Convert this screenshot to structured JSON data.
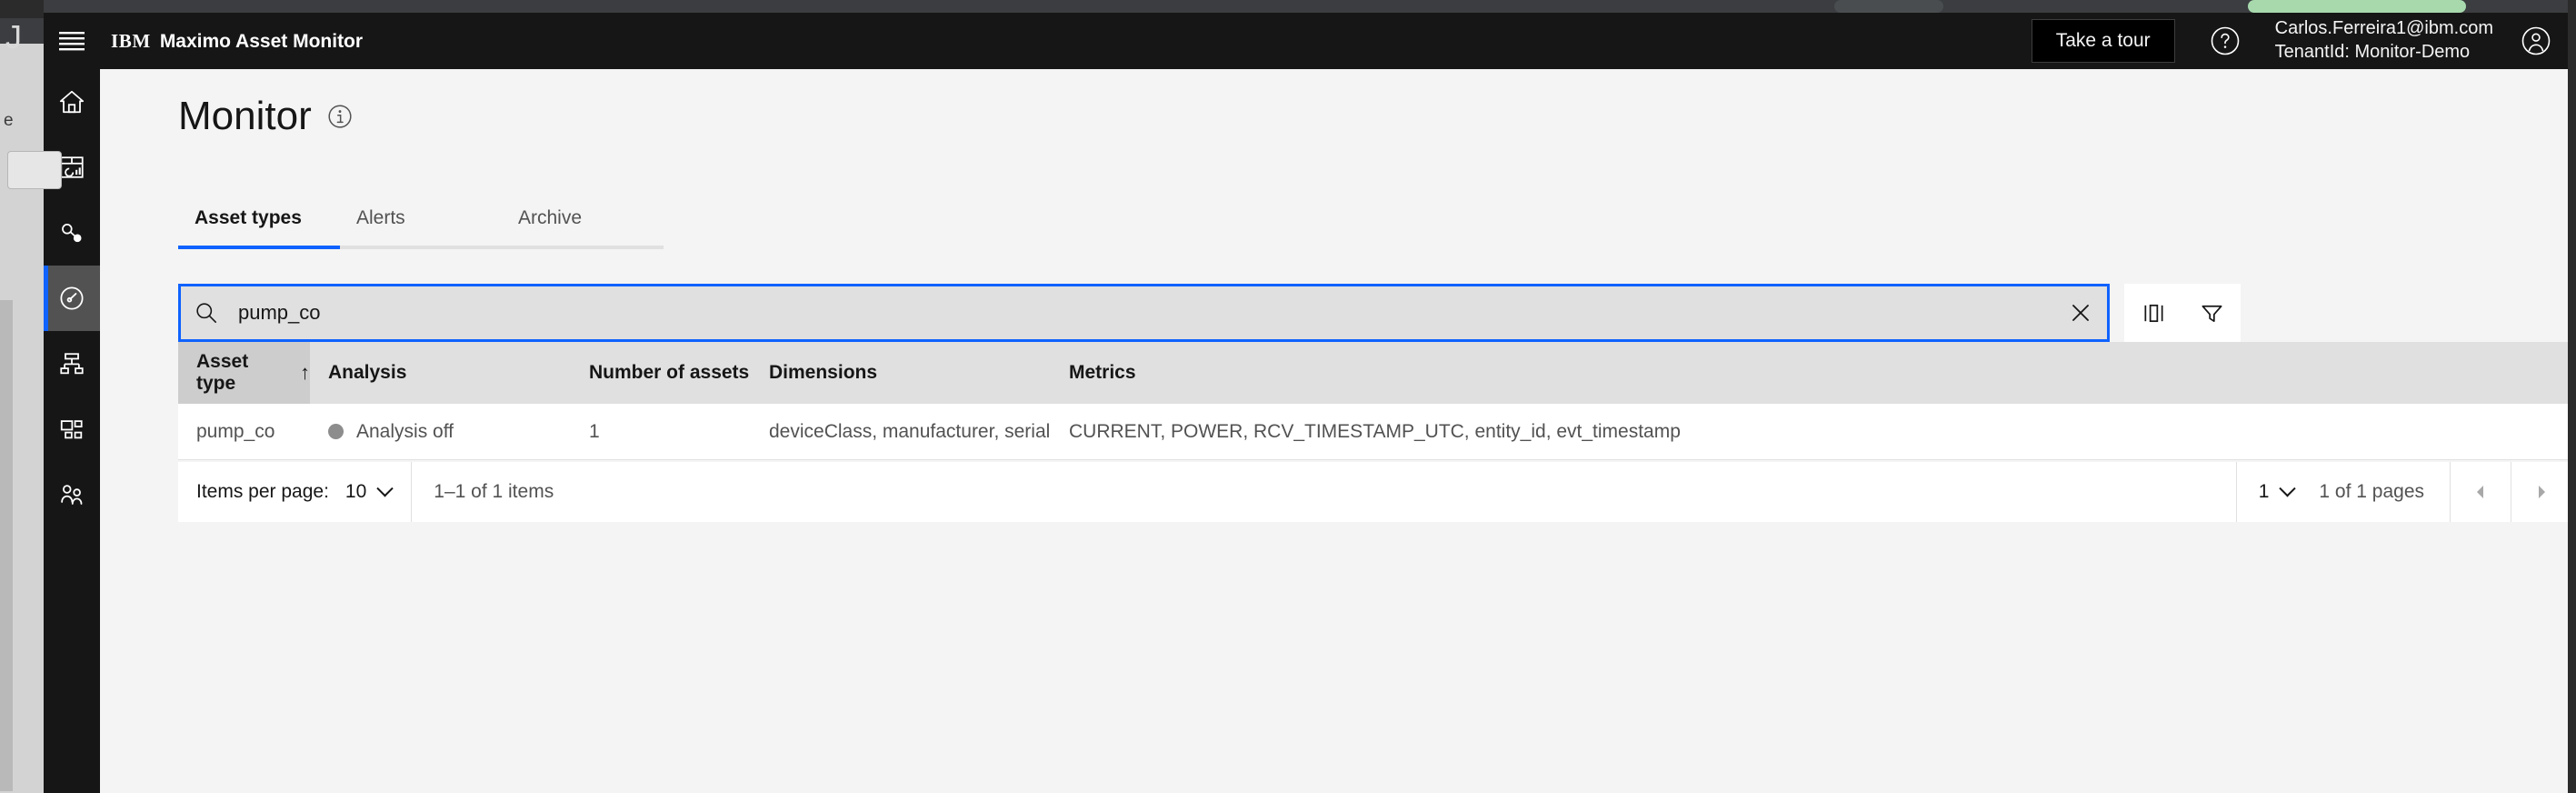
{
  "header": {
    "menu_icon": "hamburger-icon",
    "brand_prefix": "IBM",
    "brand_product": "Maximo Asset Monitor",
    "tour_button": "Take a tour",
    "help_icon": "help-circle-icon",
    "user_email": "Carlos.Ferreira1@ibm.com",
    "user_tenant": "TenantId: Monitor-Demo",
    "avatar_icon": "user-avatar-icon"
  },
  "sidebar": {
    "items": [
      {
        "icon": "home-icon",
        "name": "home",
        "active": false
      },
      {
        "icon": "dashboard-icon",
        "name": "dashboard",
        "active": false
      },
      {
        "icon": "connection-node-icon",
        "name": "devices",
        "active": false
      },
      {
        "icon": "gauge-monitor-icon",
        "name": "monitor",
        "active": true
      },
      {
        "icon": "hierarchy-icon",
        "name": "hierarchy",
        "active": false
      },
      {
        "icon": "grid-tiles-icon",
        "name": "assets",
        "active": false
      },
      {
        "icon": "users-group-icon",
        "name": "users",
        "active": false
      }
    ]
  },
  "page": {
    "title": "Monitor",
    "info_icon": "info-circle-icon"
  },
  "tabs": [
    {
      "label": "Asset types",
      "active": true
    },
    {
      "label": "Alerts",
      "active": false
    },
    {
      "label": "Archive",
      "active": false
    }
  ],
  "search": {
    "icon": "search-icon",
    "value": "pump_co",
    "placeholder": "Search",
    "clear_icon": "close-x-icon",
    "column_settings_icon": "column-settings-icon",
    "filter_icon": "filter-funnel-icon"
  },
  "table": {
    "columns": [
      {
        "label": "Asset type",
        "sorted": true,
        "sort_arrow": "↑"
      },
      {
        "label": "Analysis",
        "sorted": false,
        "sort_arrow": ""
      },
      {
        "label": "Number of assets",
        "sorted": false,
        "sort_arrow": ""
      },
      {
        "label": "Dimensions",
        "sorted": false,
        "sort_arrow": ""
      },
      {
        "label": "Metrics",
        "sorted": false,
        "sort_arrow": ""
      }
    ],
    "rows": [
      {
        "asset_type": "pump_co",
        "analysis": "Analysis off",
        "analysis_status_color": "#8d8d8d",
        "number_of_assets": "1",
        "dimensions": "deviceClass, manufacturer, serialNumber",
        "metrics": "CURRENT, POWER, RCV_TIMESTAMP_UTC, entity_id, evt_timestamp"
      }
    ]
  },
  "pagination": {
    "items_per_page_label": "Items per page:",
    "items_per_page_value": "10",
    "range_text": "1–1 of 1 items",
    "page_value": "1",
    "pages_text": "1 of 1 pages",
    "prev_icon": "caret-left-icon",
    "next_icon": "caret-right-icon"
  },
  "colors": {
    "accent_blue": "#0f62fe",
    "header_black": "#161616",
    "rail_active": "#525252",
    "table_header_bg": "#e0e0e0",
    "table_header_sorted_bg": "#cdcdcd",
    "page_bg": "#f4f4f4"
  }
}
